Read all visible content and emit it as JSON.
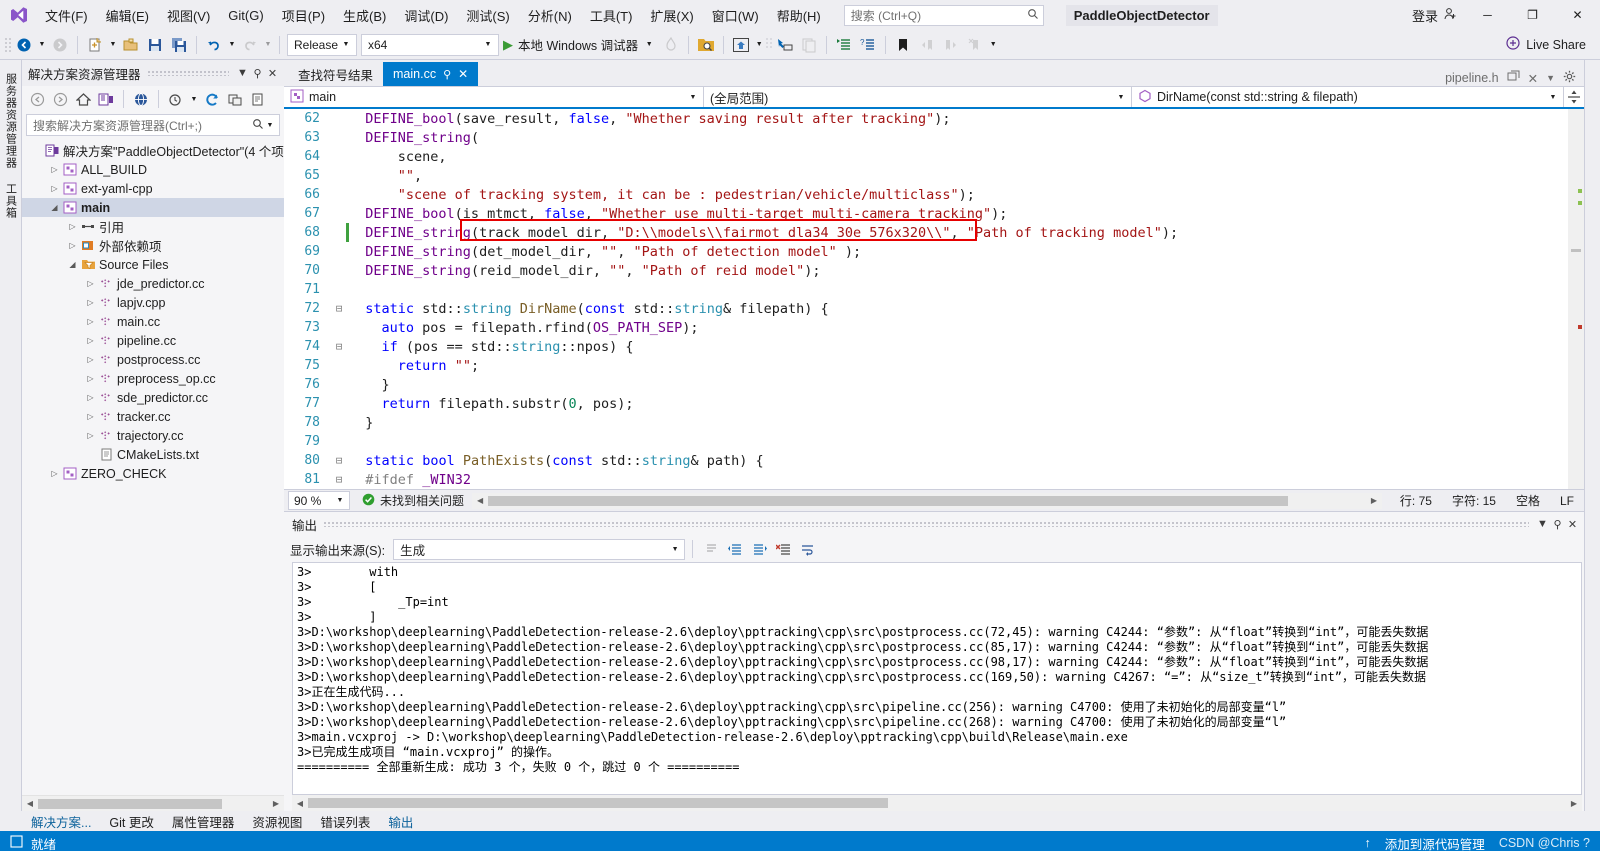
{
  "titlebar": {
    "menus": [
      "文件(F)",
      "编辑(E)",
      "视图(V)",
      "Git(G)",
      "项目(P)",
      "生成(B)",
      "调试(D)",
      "测试(S)",
      "分析(N)",
      "工具(T)",
      "扩展(X)",
      "窗口(W)",
      "帮助(H)"
    ],
    "search_placeholder": "搜索 (Ctrl+Q)",
    "project_title": "PaddleObjectDetector",
    "signin_label": "登录",
    "minimize": "─",
    "restore": "❐",
    "close": "✕"
  },
  "toolbar": {
    "config": "Release",
    "platform": "x64",
    "run_label": "本地 Windows 调试器",
    "live_share": "Live Share"
  },
  "rail_left": {
    "labels": [
      "服务器资源管理器",
      "工具箱"
    ]
  },
  "solution_explorer": {
    "title": "解决方案资源管理器",
    "search_placeholder": "搜索解决方案资源管理器(Ctrl+;)",
    "tree": [
      {
        "label": "解决方案\"PaddleObjectDetector\"(4 个项",
        "depth": 0,
        "arrow": "",
        "icon": "solution-icon",
        "selected": false
      },
      {
        "label": "ALL_BUILD",
        "depth": 1,
        "arrow": "▷",
        "icon": "project-icon",
        "selected": false
      },
      {
        "label": "ext-yaml-cpp",
        "depth": 1,
        "arrow": "▷",
        "icon": "project-icon",
        "selected": false
      },
      {
        "label": "main",
        "depth": 1,
        "arrow": "◢",
        "icon": "project-icon",
        "selected": true
      },
      {
        "label": "引用",
        "depth": 2,
        "arrow": "▷",
        "icon": "references-icon",
        "selected": false
      },
      {
        "label": "外部依赖项",
        "depth": 2,
        "arrow": "▷",
        "icon": "external-deps-icon",
        "selected": false
      },
      {
        "label": "Source Files",
        "depth": 2,
        "arrow": "◢",
        "icon": "filter-folder-icon",
        "selected": false
      },
      {
        "label": "jde_predictor.cc",
        "depth": 3,
        "arrow": "▷",
        "icon": "cpp-file-icon",
        "selected": false
      },
      {
        "label": "lapjv.cpp",
        "depth": 3,
        "arrow": "▷",
        "icon": "cpp-file-icon",
        "selected": false
      },
      {
        "label": "main.cc",
        "depth": 3,
        "arrow": "▷",
        "icon": "cpp-file-icon",
        "selected": false
      },
      {
        "label": "pipeline.cc",
        "depth": 3,
        "arrow": "▷",
        "icon": "cpp-file-icon",
        "selected": false
      },
      {
        "label": "postprocess.cc",
        "depth": 3,
        "arrow": "▷",
        "icon": "cpp-file-icon",
        "selected": false
      },
      {
        "label": "preprocess_op.cc",
        "depth": 3,
        "arrow": "▷",
        "icon": "cpp-file-icon",
        "selected": false
      },
      {
        "label": "sde_predictor.cc",
        "depth": 3,
        "arrow": "▷",
        "icon": "cpp-file-icon",
        "selected": false
      },
      {
        "label": "tracker.cc",
        "depth": 3,
        "arrow": "▷",
        "icon": "cpp-file-icon",
        "selected": false
      },
      {
        "label": "trajectory.cc",
        "depth": 3,
        "arrow": "▷",
        "icon": "cpp-file-icon",
        "selected": false
      },
      {
        "label": "CMakeLists.txt",
        "depth": 3,
        "arrow": "",
        "icon": "text-file-icon",
        "selected": false
      },
      {
        "label": "ZERO_CHECK",
        "depth": 1,
        "arrow": "▷",
        "icon": "project-icon",
        "selected": false
      }
    ]
  },
  "editor": {
    "tabs": [
      {
        "label": "查找符号结果",
        "active": false
      },
      {
        "label": "main.cc",
        "active": true
      }
    ],
    "tab_right": "pipeline.h",
    "nav_left": "main",
    "nav_mid": "(全局范围)",
    "nav_right": "DirName(const std::string & filepath)",
    "zoom": "90 %",
    "issues": "未找到相关问题",
    "line": "行: 75",
    "col": "字符: 15",
    "spaces": "空格",
    "eol": "LF"
  },
  "code_lines": [
    {
      "num": 62,
      "fold": "",
      "changed": false,
      "tokens": [
        {
          "t": "  ",
          "c": "plain"
        },
        {
          "t": "DEFINE_bool",
          "c": "mac"
        },
        {
          "t": "(save_result, ",
          "c": "plain"
        },
        {
          "t": "false",
          "c": "kw"
        },
        {
          "t": ", ",
          "c": "plain"
        },
        {
          "t": "\"Whether saving result after tracking\"",
          "c": "str"
        },
        {
          "t": ");",
          "c": "plain"
        }
      ]
    },
    {
      "num": 63,
      "fold": "",
      "changed": false,
      "tokens": [
        {
          "t": "  ",
          "c": "plain"
        },
        {
          "t": "DEFINE_string",
          "c": "mac"
        },
        {
          "t": "(",
          "c": "plain"
        }
      ]
    },
    {
      "num": 64,
      "fold": "",
      "changed": false,
      "tokens": [
        {
          "t": "      scene,",
          "c": "plain"
        }
      ]
    },
    {
      "num": 65,
      "fold": "",
      "changed": false,
      "tokens": [
        {
          "t": "      ",
          "c": "plain"
        },
        {
          "t": "\"\"",
          "c": "str"
        },
        {
          "t": ",",
          "c": "plain"
        }
      ]
    },
    {
      "num": 66,
      "fold": "",
      "changed": false,
      "tokens": [
        {
          "t": "      ",
          "c": "plain"
        },
        {
          "t": "\"scene of tracking system, it can be : pedestrian/vehicle/multiclass\"",
          "c": "str"
        },
        {
          "t": ");",
          "c": "plain"
        }
      ]
    },
    {
      "num": 67,
      "fold": "",
      "changed": false,
      "tokens": [
        {
          "t": "  ",
          "c": "plain"
        },
        {
          "t": "DEFINE_bool",
          "c": "mac"
        },
        {
          "t": "(is_mtmct, ",
          "c": "plain"
        },
        {
          "t": "false",
          "c": "kw"
        },
        {
          "t": ", ",
          "c": "plain"
        },
        {
          "t": "\"Whether use multi-target multi-camera tracking\"",
          "c": "str"
        },
        {
          "t": ");",
          "c": "plain"
        }
      ]
    },
    {
      "num": 68,
      "fold": "",
      "changed": true,
      "tokens": [
        {
          "t": "  ",
          "c": "plain"
        },
        {
          "t": "DEFINE_string",
          "c": "mac"
        },
        {
          "t": "(track_model_dir, ",
          "c": "plain"
        },
        {
          "t": "\"D:\\\\models\\\\fairmot_dla34_30e_576x320\\\\\"",
          "c": "str"
        },
        {
          "t": ", ",
          "c": "plain"
        },
        {
          "t": "\"Path of tracking model\"",
          "c": "str"
        },
        {
          "t": ");",
          "c": "plain"
        }
      ]
    },
    {
      "num": 69,
      "fold": "",
      "changed": false,
      "tokens": [
        {
          "t": "  ",
          "c": "plain"
        },
        {
          "t": "DEFINE_string",
          "c": "mac"
        },
        {
          "t": "(det_model_dir, ",
          "c": "plain"
        },
        {
          "t": "\"\"",
          "c": "str"
        },
        {
          "t": ", ",
          "c": "plain"
        },
        {
          "t": "\"Path of detection model\"",
          "c": "str"
        },
        {
          "t": " );",
          "c": "plain"
        }
      ]
    },
    {
      "num": 70,
      "fold": "",
      "changed": false,
      "tokens": [
        {
          "t": "  ",
          "c": "plain"
        },
        {
          "t": "DEFINE_string",
          "c": "mac"
        },
        {
          "t": "(reid_model_dir, ",
          "c": "plain"
        },
        {
          "t": "\"\"",
          "c": "str"
        },
        {
          "t": ", ",
          "c": "plain"
        },
        {
          "t": "\"Path of reid model\"",
          "c": "str"
        },
        {
          "t": ");",
          "c": "plain"
        }
      ]
    },
    {
      "num": 71,
      "fold": "",
      "changed": false,
      "tokens": []
    },
    {
      "num": 72,
      "fold": "⊟",
      "changed": false,
      "tokens": [
        {
          "t": "  ",
          "c": "plain"
        },
        {
          "t": "static",
          "c": "kw"
        },
        {
          "t": " std::",
          "c": "plain"
        },
        {
          "t": "string",
          "c": "typ"
        },
        {
          "t": " ",
          "c": "plain"
        },
        {
          "t": "DirName",
          "c": "fn"
        },
        {
          "t": "(",
          "c": "plain"
        },
        {
          "t": "const",
          "c": "kw"
        },
        {
          "t": " std::",
          "c": "plain"
        },
        {
          "t": "string",
          "c": "typ"
        },
        {
          "t": "& filepath) {",
          "c": "plain"
        }
      ]
    },
    {
      "num": 73,
      "fold": "",
      "changed": false,
      "tokens": [
        {
          "t": "    ",
          "c": "plain"
        },
        {
          "t": "auto",
          "c": "kw"
        },
        {
          "t": " pos = filepath.",
          "c": "plain"
        },
        {
          "t": "rfind",
          "c": "plain"
        },
        {
          "t": "(",
          "c": "plain"
        },
        {
          "t": "OS_PATH_SEP",
          "c": "mac"
        },
        {
          "t": ");",
          "c": "plain"
        }
      ]
    },
    {
      "num": 74,
      "fold": "⊟",
      "changed": false,
      "tokens": [
        {
          "t": "    ",
          "c": "plain"
        },
        {
          "t": "if",
          "c": "kw"
        },
        {
          "t": " (pos == std::",
          "c": "plain"
        },
        {
          "t": "string",
          "c": "typ"
        },
        {
          "t": "::npos) {",
          "c": "plain"
        }
      ]
    },
    {
      "num": 75,
      "fold": "",
      "changed": false,
      "tokens": [
        {
          "t": "      ",
          "c": "plain"
        },
        {
          "t": "return",
          "c": "kw"
        },
        {
          "t": " ",
          "c": "plain"
        },
        {
          "t": "\"\"",
          "c": "str"
        },
        {
          "t": ";",
          "c": "plain"
        }
      ]
    },
    {
      "num": 76,
      "fold": "",
      "changed": false,
      "tokens": [
        {
          "t": "    }",
          "c": "plain"
        }
      ]
    },
    {
      "num": 77,
      "fold": "",
      "changed": false,
      "tokens": [
        {
          "t": "    ",
          "c": "plain"
        },
        {
          "t": "return",
          "c": "kw"
        },
        {
          "t": " filepath.substr(",
          "c": "plain"
        },
        {
          "t": "0",
          "c": "num"
        },
        {
          "t": ", pos);",
          "c": "plain"
        }
      ]
    },
    {
      "num": 78,
      "fold": "",
      "changed": false,
      "tokens": [
        {
          "t": "  }",
          "c": "plain"
        }
      ]
    },
    {
      "num": 79,
      "fold": "",
      "changed": false,
      "tokens": []
    },
    {
      "num": 80,
      "fold": "⊟",
      "changed": false,
      "tokens": [
        {
          "t": "  ",
          "c": "plain"
        },
        {
          "t": "static",
          "c": "kw"
        },
        {
          "t": " ",
          "c": "plain"
        },
        {
          "t": "bool",
          "c": "kw"
        },
        {
          "t": " ",
          "c": "plain"
        },
        {
          "t": "PathExists",
          "c": "fn"
        },
        {
          "t": "(",
          "c": "plain"
        },
        {
          "t": "const",
          "c": "kw"
        },
        {
          "t": " std::",
          "c": "plain"
        },
        {
          "t": "string",
          "c": "typ"
        },
        {
          "t": "& path) {",
          "c": "plain"
        }
      ]
    },
    {
      "num": 81,
      "fold": "⊟",
      "changed": false,
      "tokens": [
        {
          "t": "  ",
          "c": "plain"
        },
        {
          "t": "#ifdef",
          "c": "pp"
        },
        {
          "t": " ",
          "c": "plain"
        },
        {
          "t": "_WIN32",
          "c": "mac"
        }
      ]
    }
  ],
  "output": {
    "title": "输出",
    "source_label": "显示输出来源(S):",
    "source_value": "生成",
    "lines": [
      "3>        with",
      "3>        [",
      "3>            _Tp=int",
      "3>        ]",
      "3>D:\\workshop\\deeplearning\\PaddleDetection-release-2.6\\deploy\\pptracking\\cpp\\src\\postprocess.cc(72,45): warning C4244: “参数”: 从“float”转换到“int”，可能丢失数据",
      "3>D:\\workshop\\deeplearning\\PaddleDetection-release-2.6\\deploy\\pptracking\\cpp\\src\\postprocess.cc(85,17): warning C4244: “参数”: 从“float”转换到“int”，可能丢失数据",
      "3>D:\\workshop\\deeplearning\\PaddleDetection-release-2.6\\deploy\\pptracking\\cpp\\src\\postprocess.cc(98,17): warning C4244: “参数”: 从“float”转换到“int”，可能丢失数据",
      "3>D:\\workshop\\deeplearning\\PaddleDetection-release-2.6\\deploy\\pptracking\\cpp\\src\\postprocess.cc(169,50): warning C4267: “=”: 从“size_t”转换到“int”，可能丢失数据",
      "3>正在生成代码...",
      "3>D:\\workshop\\deeplearning\\PaddleDetection-release-2.6\\deploy\\pptracking\\cpp\\src\\pipeline.cc(256): warning C4700: 使用了未初始化的局部变量“l”",
      "3>D:\\workshop\\deeplearning\\PaddleDetection-release-2.6\\deploy\\pptracking\\cpp\\src\\pipeline.cc(268): warning C4700: 使用了未初始化的局部变量“l”",
      "3>main.vcxproj -> D:\\workshop\\deeplearning\\PaddleDetection-release-2.6\\deploy\\pptracking\\cpp\\build\\Release\\main.exe",
      "3>已完成生成项目 “main.vcxproj” 的操作。",
      "========== 全部重新生成: 成功 3 个，失败 0 个，跳过 0 个 =========="
    ]
  },
  "bottom_tabs": [
    {
      "label": "解决方案...",
      "active": true
    },
    {
      "label": "Git 更改",
      "active": false
    },
    {
      "label": "属性管理器",
      "active": false
    },
    {
      "label": "资源视图",
      "active": false
    },
    {
      "label": "错误列表",
      "active": false
    },
    {
      "label": "输出",
      "active": true
    }
  ],
  "statusbar": {
    "ready": "就绪",
    "source_control": "添加到源代码管理",
    "watermark": "CSDN @Chris ?",
    "arrow": "↑"
  },
  "colors": {
    "accent": "#007acc",
    "highlight_box": "#e60000",
    "change_bar": "#3fa13f",
    "chrome": "#eeeef2"
  }
}
